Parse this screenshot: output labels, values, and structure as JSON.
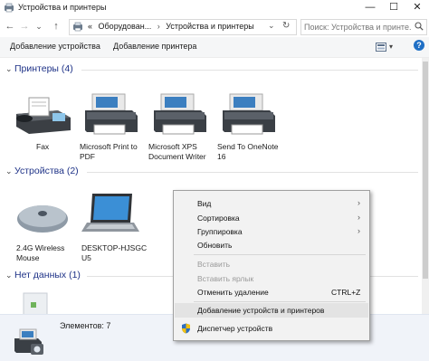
{
  "window": {
    "title": "Устройства и принтеры",
    "minimize": "—",
    "maximize": "☐",
    "close": "✕"
  },
  "address": {
    "back": "←",
    "forward": "→",
    "history": "⌄",
    "up": "↑",
    "prefix": "«",
    "crumbs": [
      "Оборудован...",
      "Устройства и принтеры"
    ],
    "separator": "›",
    "dropdown": "⌄",
    "refresh": "↻",
    "search_placeholder": "Поиск: Устройства и принте..."
  },
  "toolbar": {
    "add_device": "Добавление устройства",
    "add_printer": "Добавление принтера",
    "view_arrow": "▾",
    "help": "?"
  },
  "groups": {
    "printers": {
      "header": "Принтеры (4)",
      "items": [
        {
          "label": "Fax",
          "icon": "fax-icon"
        },
        {
          "label": "Microsoft Print to PDF",
          "icon": "printer-icon"
        },
        {
          "label": "Microsoft XPS Document Writer",
          "icon": "printer-icon"
        },
        {
          "label": "Send To OneNote 16",
          "icon": "printer-icon"
        }
      ]
    },
    "devices": {
      "header": "Устройства (2)",
      "items": [
        {
          "label": "2.4G Wireless Mouse",
          "icon": "mouse-icon"
        },
        {
          "label": "DESKTOP-HJSGC U5",
          "icon": "laptop-icon"
        }
      ]
    },
    "nodata": {
      "header": "Нет данных (1)"
    }
  },
  "status": {
    "count": "Элементов: 7"
  },
  "context_menu": {
    "items": [
      {
        "label": "Вид",
        "submenu": true,
        "disabled": false
      },
      {
        "label": "Сортировка",
        "submenu": true,
        "disabled": false
      },
      {
        "label": "Группировка",
        "submenu": true,
        "disabled": false
      },
      {
        "label": "Обновить",
        "submenu": false,
        "disabled": false
      },
      {
        "label": "Вставить",
        "submenu": false,
        "disabled": true
      },
      {
        "label": "Вставить ярлык",
        "submenu": false,
        "disabled": true
      },
      {
        "label": "Отменить удаление",
        "shortcut": "CTRL+Z",
        "submenu": false,
        "disabled": false
      },
      {
        "label": "Добавление устройств и принтеров",
        "submenu": false,
        "disabled": false,
        "highlighted": true
      },
      {
        "label": "Диспетчер устройств",
        "submenu": false,
        "disabled": false,
        "icon": "shield-icon"
      }
    ],
    "submenu_arrow": "›"
  },
  "colors": {
    "group_header": "#1e3287",
    "status_bar": "#f0f3f9",
    "menu_bg": "#f2f2f2"
  }
}
